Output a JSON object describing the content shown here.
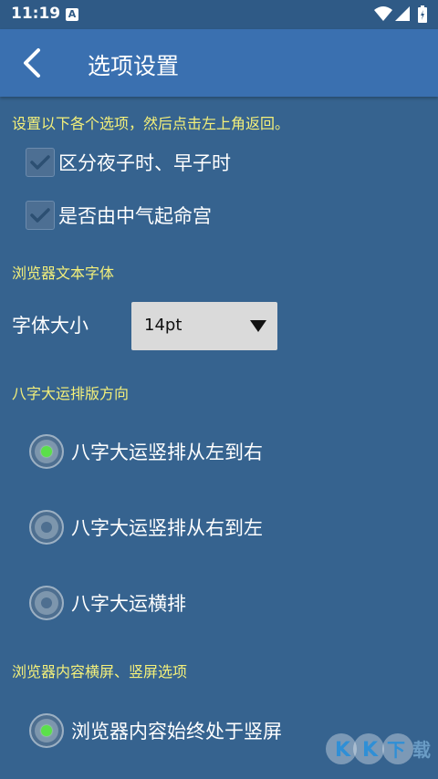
{
  "status_bar": {
    "time": "11:19",
    "a_icon": "A"
  },
  "header": {
    "title": "选项设置"
  },
  "hint": "设置以下各个选项，然后点击左上角返回。",
  "checkboxes": [
    {
      "label": "区分夜子时、早子时",
      "checked": true
    },
    {
      "label": "是否由中气起命宫",
      "checked": true
    }
  ],
  "sections": {
    "browser_font": "浏览器文本字体",
    "layout_direction": "八字大运排版方向",
    "orientation": "浏览器内容横屏、竖屏选项"
  },
  "font_size": {
    "label": "字体大小",
    "value": "14pt"
  },
  "layout_options": [
    {
      "label": "八字大运竖排从左到右",
      "selected": true
    },
    {
      "label": "八字大运竖排从右到左",
      "selected": false
    },
    {
      "label": "八字大运横排",
      "selected": false
    }
  ],
  "orientation_options": [
    {
      "label": "浏览器内容始终处于竖屏",
      "selected": true
    }
  ],
  "watermark": "KK下载"
}
